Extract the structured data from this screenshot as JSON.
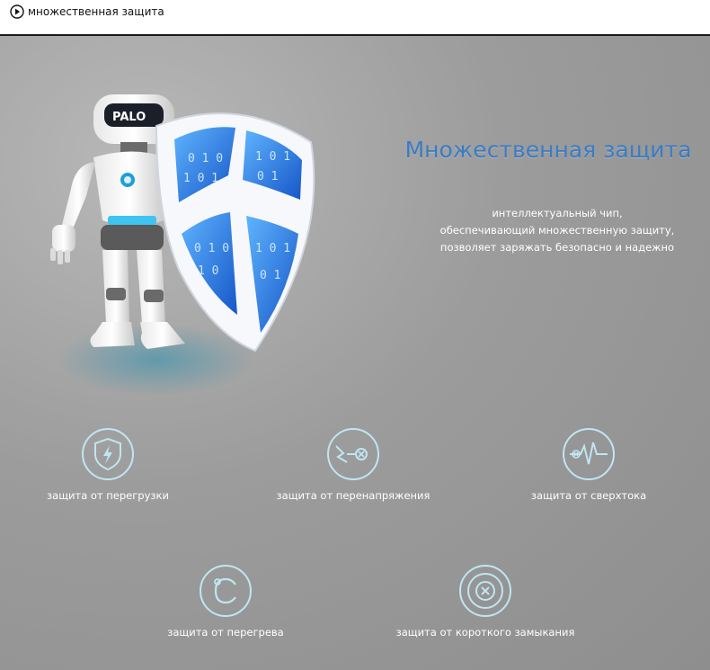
{
  "header": {
    "title": "множественная защита",
    "icon": "play-circle-icon"
  },
  "hero": {
    "robot_badge": "PALO",
    "headline": "Множественная защита",
    "headline_color": "#3a7cc4",
    "description": [
      "интеллектуальный чип,",
      "обеспечивающий множественную защиту,",
      "позволяет заряжать безопасно и надежно"
    ]
  },
  "features": [
    {
      "label": "защита от перегрузки",
      "icon": "shield-lightning-icon"
    },
    {
      "label": "защита от перенапряжения",
      "icon": "voltage-cross-icon"
    },
    {
      "label": "защита от сверхтока",
      "icon": "pulse-wave-icon"
    },
    {
      "label": "защита от перегрева",
      "icon": "temperature-celsius-icon"
    },
    {
      "label": "защита от короткого замыкания",
      "icon": "short-circuit-x-icon"
    }
  ]
}
